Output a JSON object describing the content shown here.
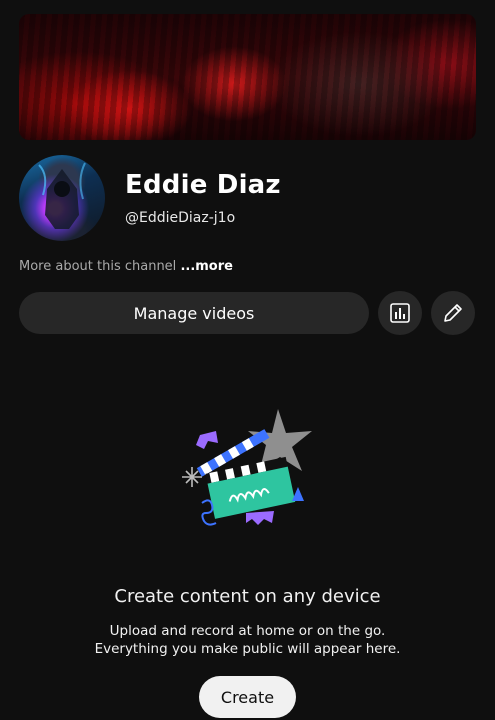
{
  "channel": {
    "name": "Eddie Diaz",
    "handle": "@EddieDiaz-j1o",
    "about_text": "More about this channel ",
    "about_more": "...more"
  },
  "actions": {
    "manage_videos": "Manage videos",
    "analytics_icon": "bar-chart-icon",
    "edit_icon": "pencil-icon"
  },
  "empty_state": {
    "title": "Create content on any device",
    "line1": "Upload and record at home or on the go.",
    "line2": "Everything you make public will appear here.",
    "create_label": "Create"
  },
  "colors": {
    "background": "#0f0f0f",
    "button_dark": "#272727",
    "button_light": "#f1f1f1",
    "muted_text": "#aaaaaa"
  }
}
